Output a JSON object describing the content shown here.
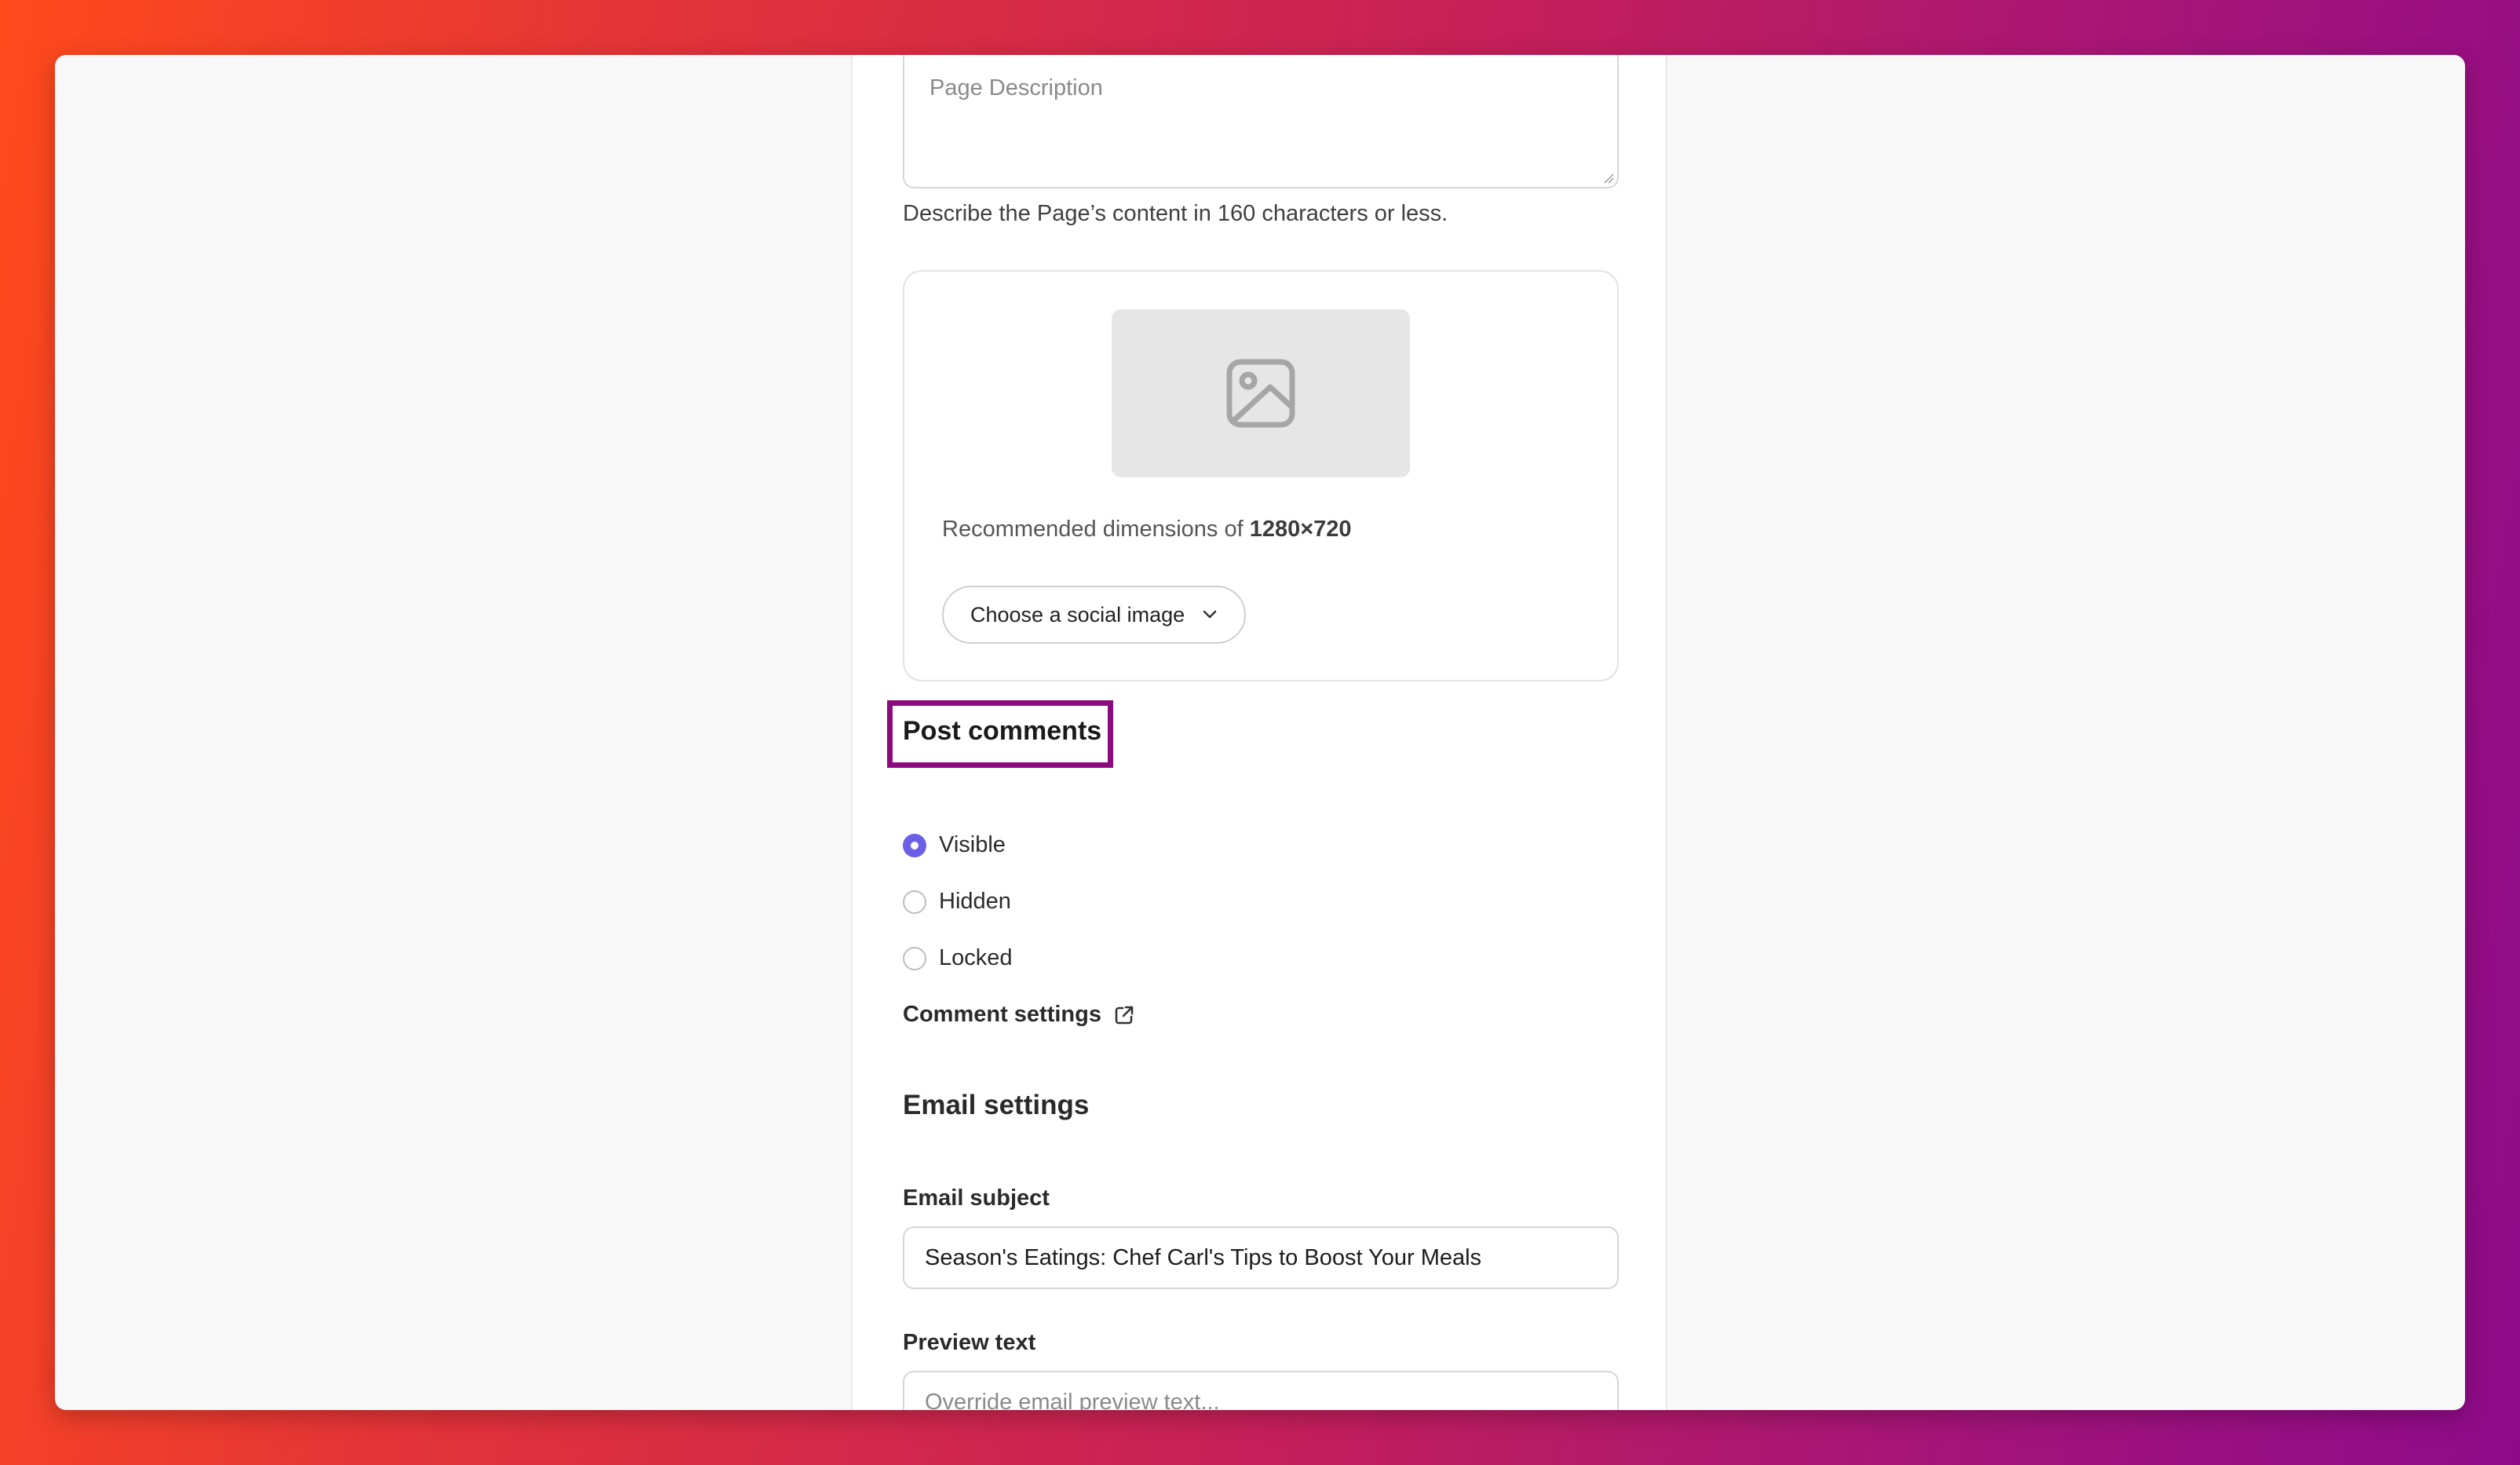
{
  "page_description": {
    "placeholder": "Page Description",
    "help_text": "Describe the Page’s content in 160 characters or less."
  },
  "social_image": {
    "recommended_prefix": "Recommended dimensions of",
    "recommended_value": "1280×720",
    "choose_label": "Choose a social image"
  },
  "post_comments": {
    "title": "Post comments",
    "options": [
      {
        "label": "Visible",
        "selected": true
      },
      {
        "label": "Hidden",
        "selected": false
      },
      {
        "label": "Locked",
        "selected": false
      }
    ],
    "settings_link": "Comment settings"
  },
  "email_settings": {
    "title": "Email settings",
    "subject_label": "Email subject",
    "subject_value": "Season's Eatings: Chef Carl's Tips to Boost Your Meals",
    "preview_label": "Preview text",
    "preview_placeholder": "Override email preview text..."
  },
  "colors": {
    "accent": "#6a5fe6",
    "highlight_box": "#8b0b7f"
  }
}
